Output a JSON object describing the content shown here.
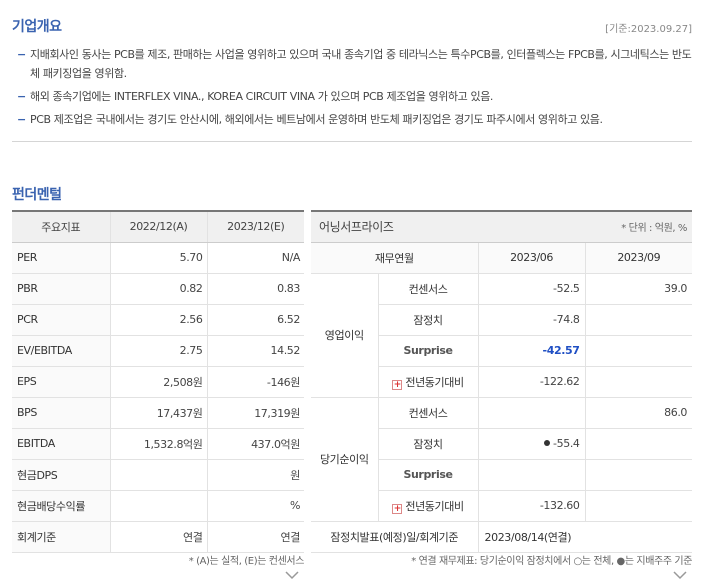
{
  "overview": {
    "title": "기업개요",
    "as_of": "[기준:2023.09.27]",
    "items": [
      "지배회사인 동사는 PCB를 제조, 판매하는 사업을 영위하고 있으며 국내 종속기업 중 테라닉스는 특수PCB를, 인터플렉스는 FPCB를, 시그네틱스는 반도체 패키징업을 영위함.",
      "해외 종속기업에는 INTERFLEX VINA., KOREA CIRCUIT VINA 가 있으며 PCB 제조업을 영위하고 있음.",
      "PCB 제조업은 국내에서는 경기도 안산시에, 해외에서는 베트남에서 운영하며 반도체 패키징업은 경기도 파주시에서 영위하고 있음."
    ]
  },
  "fundamental": {
    "title": "펀더멘털",
    "headers": [
      "주요지표",
      "2022/12(A)",
      "2023/12(E)"
    ],
    "rows": [
      {
        "label": "PER",
        "a": "5.70",
        "e": "N/A"
      },
      {
        "label": "PBR",
        "a": "0.82",
        "e": "0.83"
      },
      {
        "label": "PCR",
        "a": "2.56",
        "e": "6.52"
      },
      {
        "label": "EV/EBITDA",
        "a": "2.75",
        "e": "14.52"
      },
      {
        "label": "EPS",
        "a": "2,508원",
        "e": "-146원"
      },
      {
        "label": "BPS",
        "a": "17,437원",
        "e": "17,319원"
      },
      {
        "label": "EBITDA",
        "a": "1,532.8억원",
        "e": "437.0억원"
      },
      {
        "label": "현금DPS",
        "a": "",
        "e": "원"
      },
      {
        "label": "현금배당수익률",
        "a": "",
        "e": "%"
      },
      {
        "label": "회계기준",
        "a": "연결",
        "e": "연결"
      }
    ],
    "footnote": "* (A)는 실적, (E)는 컨센서스"
  },
  "earning": {
    "title": "어닝서프라이즈",
    "unit": "* 단위 : 억원, %",
    "headers": [
      "재무연월",
      "2023/06",
      "2023/09"
    ],
    "groups": [
      {
        "name": "영업이익",
        "rows": [
          {
            "label": "컨센서스",
            "v1": "-52.5",
            "v2": "39.0"
          },
          {
            "label": "잠정치",
            "v1": "-74.8",
            "v2": ""
          },
          {
            "label": "Surprise",
            "v1": "-42.57",
            "v2": ""
          },
          {
            "label": "전년동기대비",
            "v1": "-122.62",
            "v2": ""
          }
        ]
      },
      {
        "name": "당기순이익",
        "rows": [
          {
            "label": "컨센서스",
            "v1": "",
            "v2": "86.0"
          },
          {
            "label": "잠정치",
            "v1": "-55.4",
            "v2": ""
          },
          {
            "label": "Surprise",
            "v1": "",
            "v2": ""
          },
          {
            "label": "전년동기대비",
            "v1": "-132.60",
            "v2": ""
          }
        ]
      }
    ],
    "footer_label": "잠정치발표(예정)일/회계기준",
    "footer_value": "2023/08/14(연결)",
    "footnote": "* 연결 재무제표: 당기순이익 잠정치에서 ○는 전체, ●는 지배주주 기준"
  },
  "colors": {
    "accent": "#3a63b0",
    "surprise_blue": "#1f4fc4"
  }
}
